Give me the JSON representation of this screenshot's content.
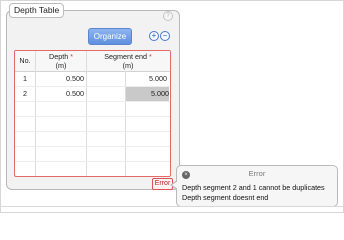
{
  "panel": {
    "title": "Depth Table",
    "help": "?",
    "organize_label": "Organize",
    "add_symbol": "+",
    "remove_symbol": "−"
  },
  "table": {
    "headers": {
      "no": "No.",
      "depth_line1": "Depth",
      "depth_line2": "(m)",
      "seg_line1": "Segment end",
      "seg_line2": "(m)",
      "required_marker": "*"
    },
    "rows": [
      {
        "no": "1",
        "depth": "0.500",
        "segment_end": "5.000"
      },
      {
        "no": "2",
        "depth": "0.500",
        "segment_end": "5.000"
      }
    ],
    "selected_row": 2
  },
  "error": {
    "tab_label": "Error",
    "tooltip_title": "Error",
    "close_symbol": "×",
    "messages": [
      "Depth segment 2 and 1 cannot be duplicates",
      "Depth segment doesnt end"
    ]
  },
  "colors": {
    "accent": "#6b97e4",
    "error": "#e05252",
    "selected_cell": "#c9c9c9"
  }
}
